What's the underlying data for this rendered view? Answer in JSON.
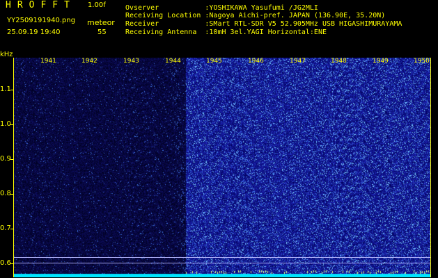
{
  "header": {
    "brand": "HROFFT",
    "version": "1.00f",
    "filename": "YY2509191940.png",
    "meteor_label": "meteor",
    "datetime": "25.09.19 19:40",
    "meteor_count": "55"
  },
  "meta": [
    {
      "label": "Ovserver           ",
      "value": ":YOSHIKAWA Yasufumi /JG2MLI"
    },
    {
      "label": "Receiving Location ",
      "value": ":Nagoya Aichi-pref. JAPAN (136.90E, 35.20N)"
    },
    {
      "label": "Receiver           ",
      "value": ":SMart RTL-SDR V5 52.905MHz USB HIGASHIMURAYAMA"
    },
    {
      "label": "Receiving Antenna  ",
      "value": ":10mH 3el.YAGI Horizontal:ENE"
    }
  ],
  "yaxis": {
    "unit": "kHz",
    "ticks": [
      "1.1",
      "1.0",
      "0.9",
      "0.8",
      "0.7",
      "0.6"
    ]
  },
  "xaxis": {
    "minutes": [
      "1941",
      "1942",
      "1943",
      "1944",
      "1945",
      "1946",
      "1947",
      "1948",
      "1949",
      "1950"
    ]
  },
  "chart_data": {
    "type": "heatmap",
    "title": "",
    "xlabel": "",
    "ylabel": "kHz",
    "x_ticks": [
      "1941",
      "1942",
      "1943",
      "1944",
      "1945",
      "1946",
      "1947",
      "1948",
      "1949",
      "1950"
    ],
    "y_ticks": [
      1.1,
      1.0,
      0.9,
      0.8,
      0.7,
      0.6
    ],
    "ylim": [
      0.58,
      1.2
    ],
    "low_noise_until_minute": "1944",
    "colors": {
      "background": "#000000",
      "axis": "#ffff00",
      "low_noise": "#0d0d4a",
      "high_noise": "#1a1aa8",
      "baseline": "#00e5ff"
    }
  }
}
